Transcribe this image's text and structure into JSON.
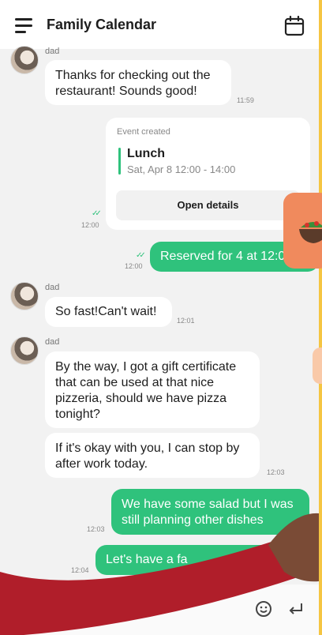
{
  "header": {
    "title": "Family Calendar"
  },
  "messages": [
    {
      "sender": "dad",
      "text": "Thanks for checking out the restaurant! Sounds good!",
      "time": "11:59"
    },
    {
      "sender": "dad",
      "text": "So fast!Can't wait!",
      "time": "12:01"
    },
    {
      "sender": "dad",
      "text": "By the way, I got a gift certificate that can be used at that nice pizzeria, should we have pizza tonight?"
    },
    {
      "text": "If it's okay with you, I can stop by after work today.",
      "time": "12:03"
    }
  ],
  "event_card": {
    "label": "Event created",
    "title": "Lunch",
    "time": "Sat, Apr 8 12:00 - 14:00",
    "button": "Open details",
    "sent_time": "12:00"
  },
  "outgoing": [
    {
      "text": "Reserved for 4 at 12:0",
      "time": "12:00"
    },
    {
      "text": "We have some salad but I was still planning other dishes",
      "time": "12:03"
    },
    {
      "text": "Let's have a fa",
      "time": "12:04"
    }
  ],
  "composer": {
    "placeholder": ""
  },
  "icons": {
    "menu": "menu-icon",
    "calendar": "calendar-icon",
    "emoji": "emoji-icon",
    "send": "enter-icon",
    "app": "salad-bowl-icon"
  },
  "colors": {
    "accent": "#2fc27c",
    "app_icon": "#f08a5d",
    "sleeve": "#b01e2a"
  }
}
